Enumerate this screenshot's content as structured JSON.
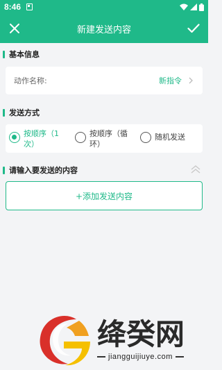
{
  "status_bar": {
    "time": "8:46",
    "icons": [
      "app-notification-icon",
      "wifi-icon",
      "signal-icon",
      "battery-icon"
    ]
  },
  "app_bar": {
    "title": "新建发送内容",
    "close_icon": "close-icon",
    "confirm_icon": "check-icon"
  },
  "basic_info": {
    "section_title": "基本信息",
    "action_name_label": "动作名称:",
    "action_name_value": "新指令"
  },
  "send_mode": {
    "section_title": "发送方式",
    "options": [
      {
        "label": "按顺序（1次）",
        "selected": true
      },
      {
        "label": "按顺序（循环）",
        "selected": false
      },
      {
        "label": "随机发送",
        "selected": false
      }
    ]
  },
  "content": {
    "section_title": "请输入要发送的内容",
    "add_label": "+添加发送内容"
  },
  "watermark": {
    "brand": "绛癸网",
    "url": "jiangguijiuye.com"
  },
  "colors": {
    "accent": "#1fb989",
    "background": "#f3f4f6"
  }
}
